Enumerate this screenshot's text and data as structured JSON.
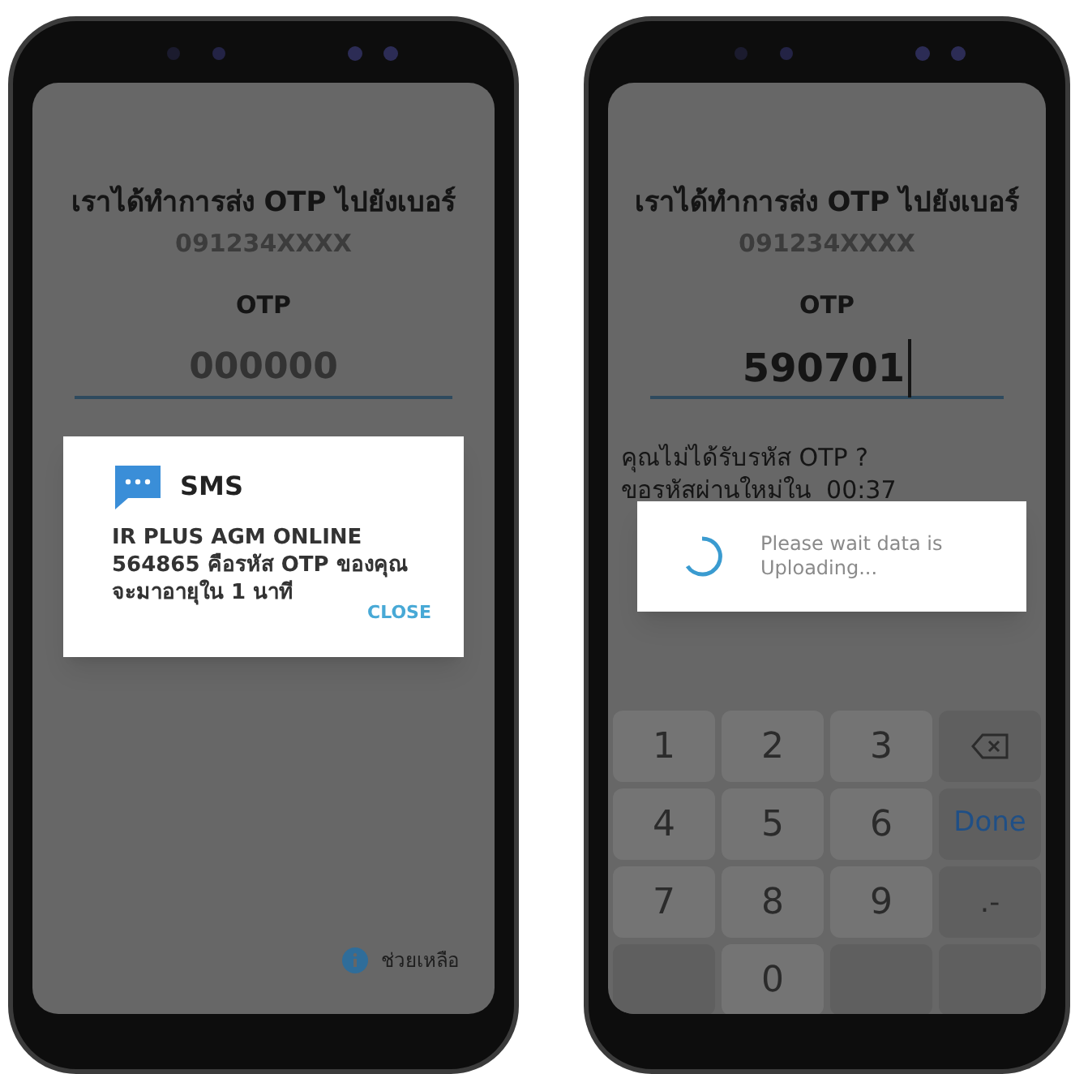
{
  "phones": [
    {
      "header": {
        "title": "เราได้ทำการส่ง OTP ไปยังเบอร์",
        "phone_number": "091234XXXX"
      },
      "otp_label": "OTP",
      "otp_field": {
        "placeholder": "000000",
        "focused": false
      },
      "sms_dialog": {
        "title": "SMS",
        "body": [
          "IR PLUS AGM ONLINE",
          "564865 คือรหัส OTP ของคุณ",
          "จะมาอายุใน 1 นาที"
        ],
        "button": "CLOSE"
      },
      "help_link": "ช่วยเหลือ"
    },
    {
      "header": {
        "title": "เราได้ทำการส่ง OTP ไปยังเบอร์",
        "phone_number": "091234XXXX"
      },
      "otp_label": "OTP",
      "otp_field": {
        "value": "590701",
        "focused": true
      },
      "resend": [
        "คุณไม่ได้รับรหัส OTP ?",
        "ขอรหัสผ่านใหม่ใน  00:37"
      ],
      "loading_dialog": {
        "message": "Please wait data is Uploading..."
      },
      "keypad": [
        {
          "kind": "digit",
          "label": "1"
        },
        {
          "kind": "digit",
          "label": "2"
        },
        {
          "kind": "digit",
          "label": "3"
        },
        {
          "kind": "backspace"
        },
        {
          "kind": "digit",
          "label": "4"
        },
        {
          "kind": "digit",
          "label": "5"
        },
        {
          "kind": "digit",
          "label": "6"
        },
        {
          "kind": "done",
          "label": "Done"
        },
        {
          "kind": "digit",
          "label": "7"
        },
        {
          "kind": "digit",
          "label": "8"
        },
        {
          "kind": "digit",
          "label": "9"
        },
        {
          "kind": "symbol",
          "label": ".-"
        },
        {
          "kind": "blank"
        },
        {
          "kind": "digit",
          "label": "0"
        },
        {
          "kind": "blank"
        },
        {
          "kind": "blank"
        }
      ]
    }
  ]
}
